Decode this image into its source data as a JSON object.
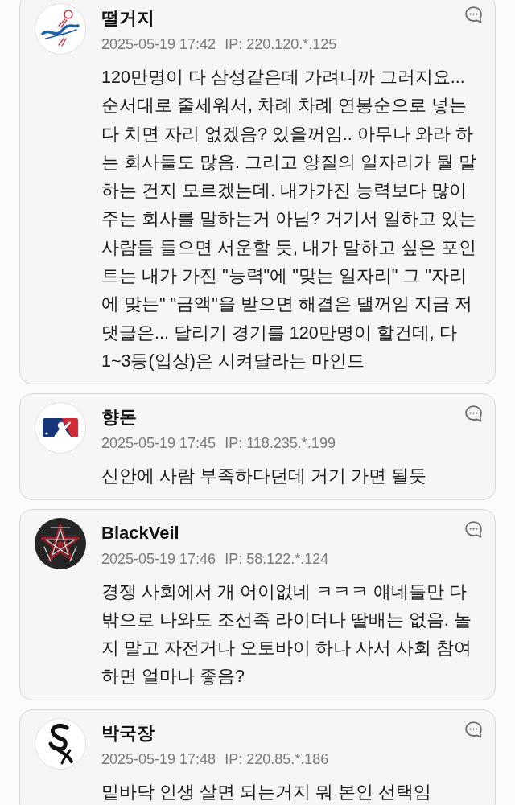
{
  "comments": [
    {
      "author": "떨거지",
      "date": "2025-05-19 17:42",
      "ip": "IP: 220.120.*.125",
      "body": "120만명이 다 삼성같은데 가려니까 그러지요... 순서대로 줄세워서, 차례 차례 연봉순으로 넣는다 치면 자리 없겠음? 있을꺼임.. 아무나 와라 하는 회사들도 많음. 그리고 양질의 일자리가 뭘 말하는 건지 모르겠는데. 내가가진 능력보다 많이 주는 회사를 말하는거 아님? 거기서 일하고 있는 사람들 들으면 서운할 듯, 내가 말하고 싶은 포인트는 내가 가진 \"능력\"에 \"맞는 일자리\" 그 \"자리에 맞는\" \"금액\"을 받으면 해결은 댈꺼임 지금 저 댓글은... 달리기 경기를 120만명이 할건데, 다 1~3등(입상)은 시켜달라는 마인드"
    },
    {
      "author": "향돈",
      "date": "2025-05-19 17:45",
      "ip": "IP: 118.235.*.199",
      "body": "신안에 사람 부족하다던데 거기 가면 될듯"
    },
    {
      "author": "BlackVeil",
      "date": "2025-05-19 17:46",
      "ip": "IP: 58.122.*.124",
      "body": "경쟁 사회에서 개 어이없네 ㅋㅋㅋ 얘네들만 다 밖으로 나와도 조선족 라이더나 딸배는 없음. 놀지 말고 자전거나 오토바이 하나 사서 사회 참여하면 얼마나 좋음?"
    },
    {
      "author": "박국장",
      "date": "2025-05-19 17:48",
      "ip": "IP: 220.85.*.186",
      "body": "밑바닥 인생 살면 되는거지 뭐 본인 선택임"
    }
  ]
}
